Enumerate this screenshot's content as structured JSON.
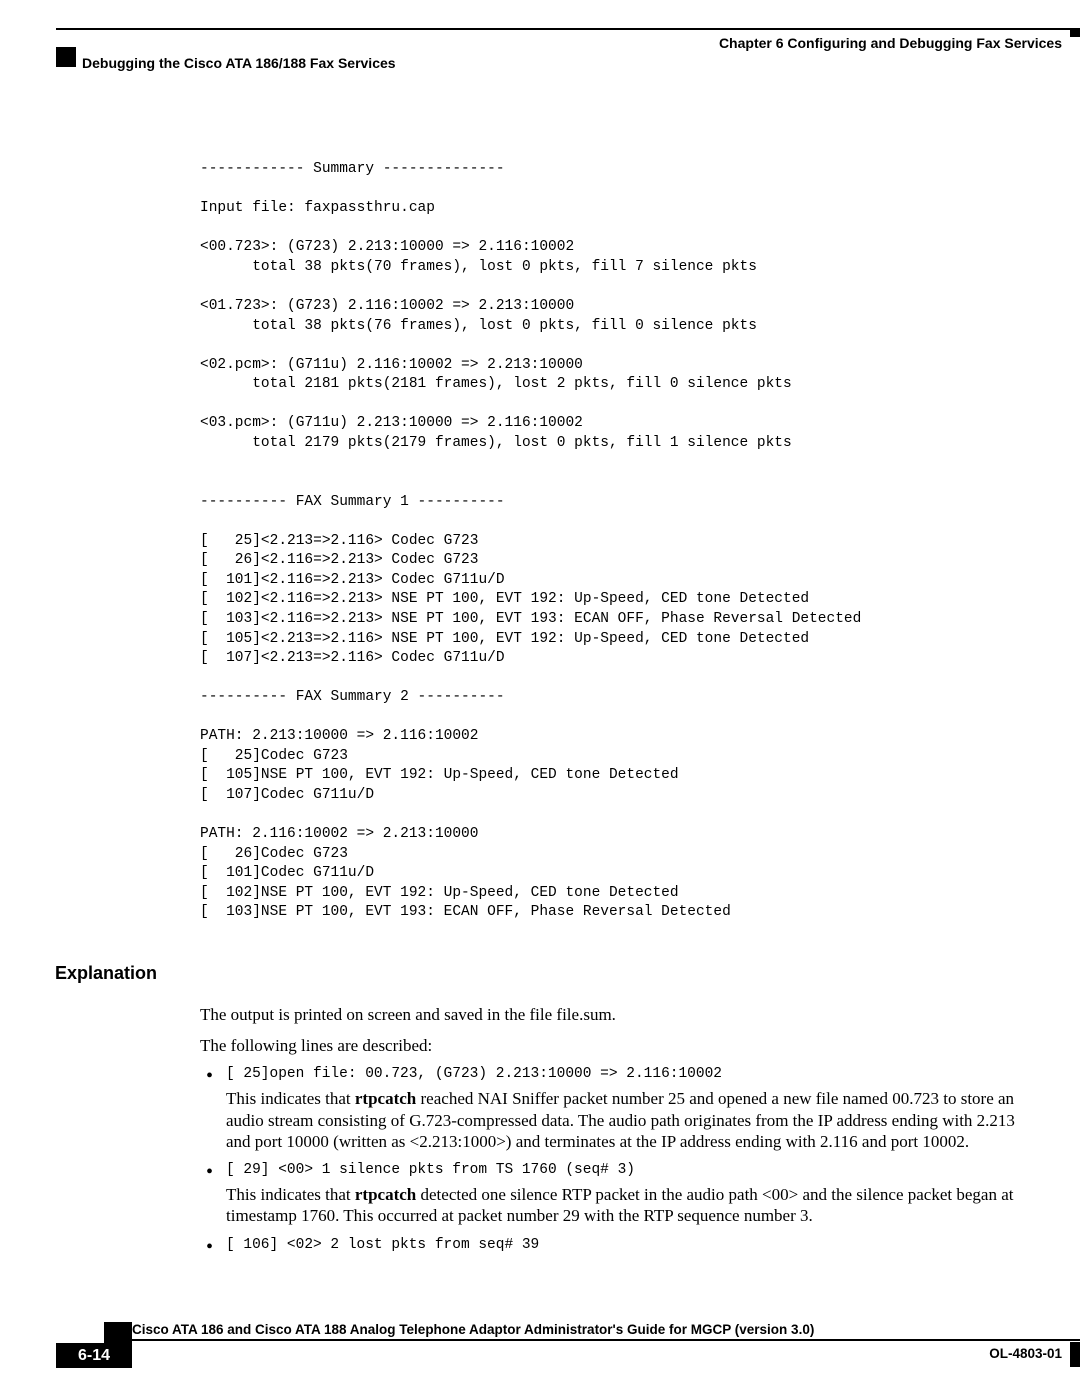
{
  "header": {
    "chapter": "Chapter 6      Configuring and Debugging Fax Services",
    "section": "Debugging the Cisco ATA 186/188 Fax Services"
  },
  "code": "------------ Summary --------------\n\nInput file: faxpassthru.cap\n\n<00.723>: (G723) 2.213:10000 => 2.116:10002\n      total 38 pkts(70 frames), lost 0 pkts, fill 7 silence pkts\n\n<01.723>: (G723) 2.116:10002 => 2.213:10000\n      total 38 pkts(76 frames), lost 0 pkts, fill 0 silence pkts\n\n<02.pcm>: (G711u) 2.116:10002 => 2.213:10000\n      total 2181 pkts(2181 frames), lost 2 pkts, fill 0 silence pkts\n\n<03.pcm>: (G711u) 2.213:10000 => 2.116:10002\n      total 2179 pkts(2179 frames), lost 0 pkts, fill 1 silence pkts\n\n\n---------- FAX Summary 1 ----------\n\n[   25]<2.213=>2.116> Codec G723\n[   26]<2.116=>2.213> Codec G723\n[  101]<2.116=>2.213> Codec G711u/D\n[  102]<2.116=>2.213> NSE PT 100, EVT 192: Up-Speed, CED tone Detected\n[  103]<2.116=>2.213> NSE PT 100, EVT 193: ECAN OFF, Phase Reversal Detected\n[  105]<2.213=>2.116> NSE PT 100, EVT 192: Up-Speed, CED tone Detected\n[  107]<2.213=>2.116> Codec G711u/D\n\n---------- FAX Summary 2 ----------\n\nPATH: 2.213:10000 => 2.116:10002\n[   25]Codec G723\n[  105]NSE PT 100, EVT 192: Up-Speed, CED tone Detected\n[  107]Codec G711u/D\n\nPATH: 2.116:10002 => 2.213:10000\n[   26]Codec G723\n[  101]Codec G711u/D\n[  102]NSE PT 100, EVT 192: Up-Speed, CED tone Detected\n[  103]NSE PT 100, EVT 193: ECAN OFF, Phase Reversal Detected",
  "explanation": {
    "heading": "Explanation",
    "para1": "The output is printed on screen and saved in the file file.sum.",
    "para2": "The following lines are described:",
    "bullets": [
      {
        "code": "[   25]open file: 00.723, (G723) 2.213:10000 => 2.116:10002",
        "body_pre": "This indicates that ",
        "body_bold": "rtpcatch",
        "body_post": " reached NAI Sniffer packet number 25 and opened a new file named 00.723 to store an audio stream consisting of G.723-compressed data. The audio path originates from the IP address ending with 2.213 and port 10000 (written as <2.213:1000>) and terminates at the IP address ending with 2.116 and port 10002."
      },
      {
        "code": "[   29] <00>  1 silence pkts from TS 1760 (seq# 3)",
        "body_pre": "This indicates that ",
        "body_bold": "rtpcatch",
        "body_post": " detected one silence RTP packet in the audio path <00> and the silence packet began at timestamp 1760. This occurred at packet number 29 with the RTP sequence number 3."
      },
      {
        "code": "[  106] <02>  2    lost pkts from seq# 39",
        "body_pre": "",
        "body_bold": "",
        "body_post": ""
      }
    ]
  },
  "footer": {
    "guide": "Cisco ATA 186 and Cisco ATA 188 Analog Telephone Adaptor Administrator's Guide for MGCP (version 3.0)",
    "page": "6-14",
    "doccode": "OL-4803-01"
  }
}
